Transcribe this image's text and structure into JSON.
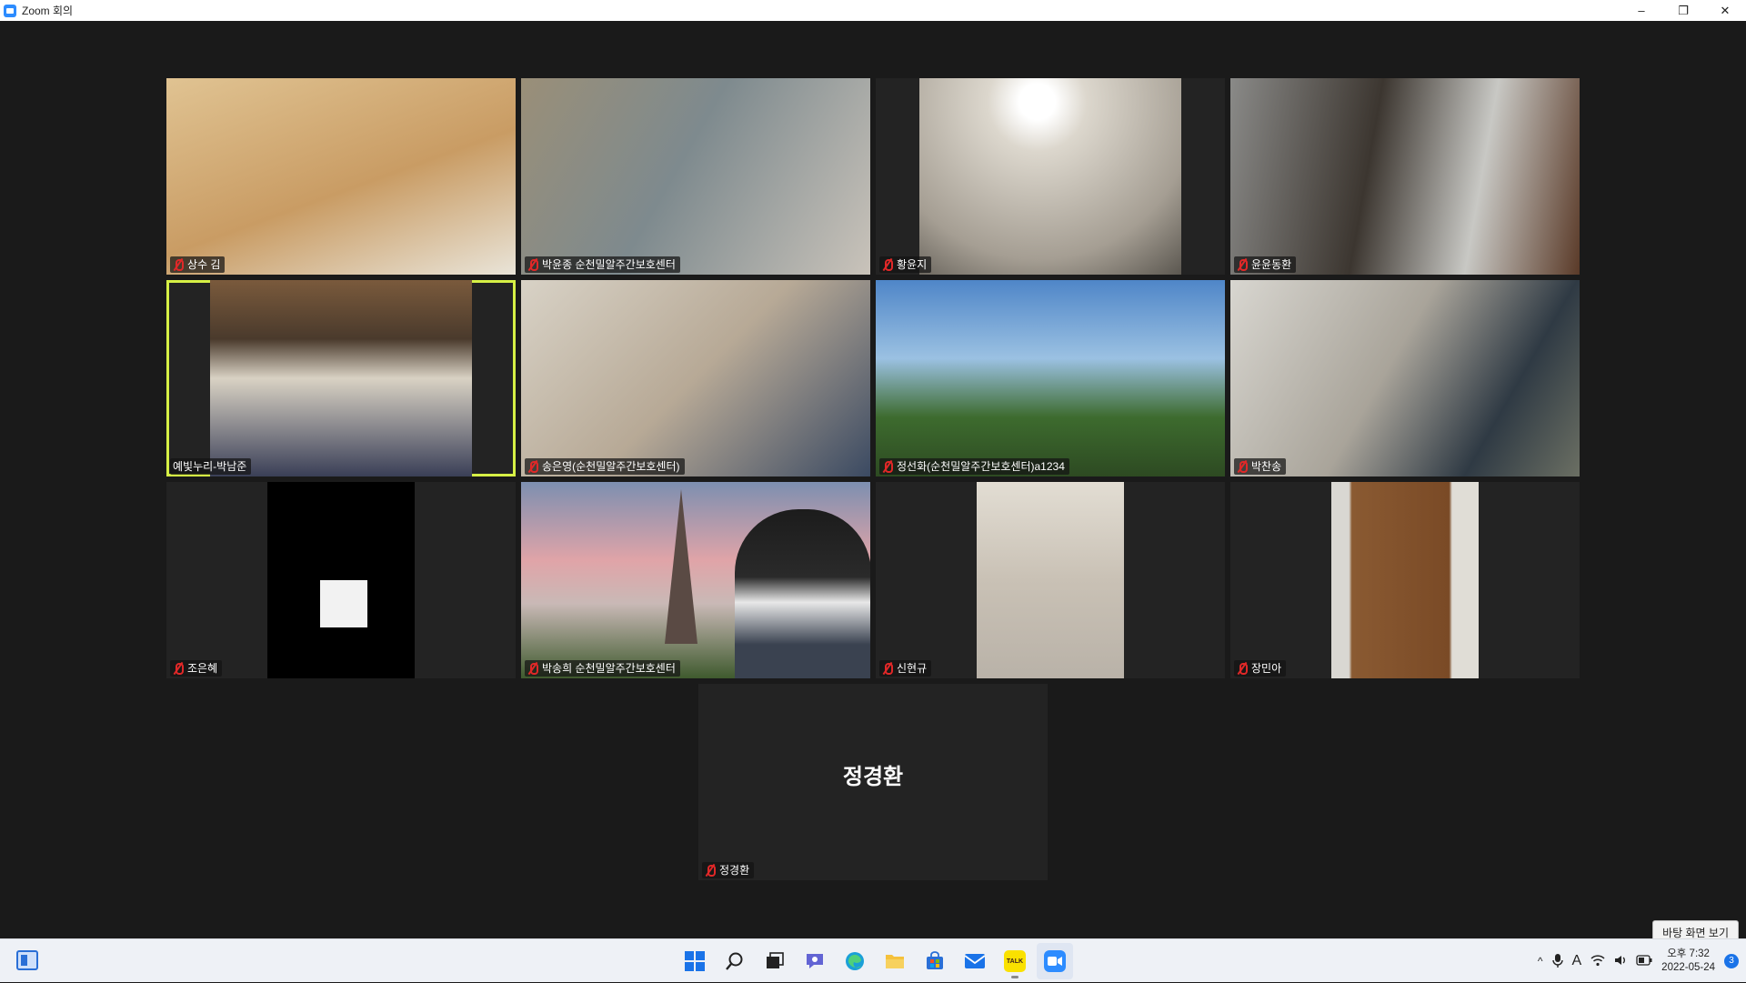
{
  "window": {
    "title": "Zoom 회의",
    "minimize": "–",
    "restore": "❐",
    "close": "✕"
  },
  "participants": [
    {
      "name": "상수 김",
      "muted": true,
      "video_color": "#cfa876"
    },
    {
      "name": "박윤종 순천밀알주간보호센터",
      "muted": true,
      "video_color": "#8e8a7e"
    },
    {
      "name": "황윤지",
      "muted": true,
      "video_color": "#b7b1a6"
    },
    {
      "name": "윤윤동환",
      "muted": true,
      "video_color": "#6f6b64"
    },
    {
      "name": "예빛누리-박남준",
      "muted": false,
      "active_speaker": true,
      "video_color": "#7a5a3c"
    },
    {
      "name": "송은영(순천밀알주간보호센터)",
      "muted": true,
      "video_color": "#c9c3b8"
    },
    {
      "name": "정선화(순천밀알주간보호센터)a1234",
      "muted": true,
      "video_color": "#5f8fb8"
    },
    {
      "name": "박찬송",
      "muted": true,
      "video_color": "#a9a49a"
    },
    {
      "name": "조은혜",
      "muted": true,
      "video_color": "#000000"
    },
    {
      "name": "박송희 순천밀알주간보호센터",
      "muted": true,
      "video_color": "#b7899a"
    },
    {
      "name": "신현규",
      "muted": true,
      "video_color": "#c9c1b5"
    },
    {
      "name": "장민아",
      "muted": true,
      "video_color": "#8a5a32"
    },
    {
      "name": "정경환",
      "muted": true,
      "video_off": true,
      "big_label": "정경환"
    }
  ],
  "desktop_peek": "바탕 화면 보기",
  "taskbar": {
    "apps": [
      "start-icon",
      "search-icon",
      "task-view-icon",
      "chat-icon",
      "edge-icon",
      "file-explorer-icon",
      "store-icon",
      "mail-icon",
      "kakaotalk-icon",
      "zoom-icon"
    ],
    "kakaotalk_label": "TALK",
    "tray": {
      "chevron": "^",
      "ime": "A",
      "time": "오후 7:32",
      "date": "2022-05-24",
      "notifications": "3"
    }
  }
}
